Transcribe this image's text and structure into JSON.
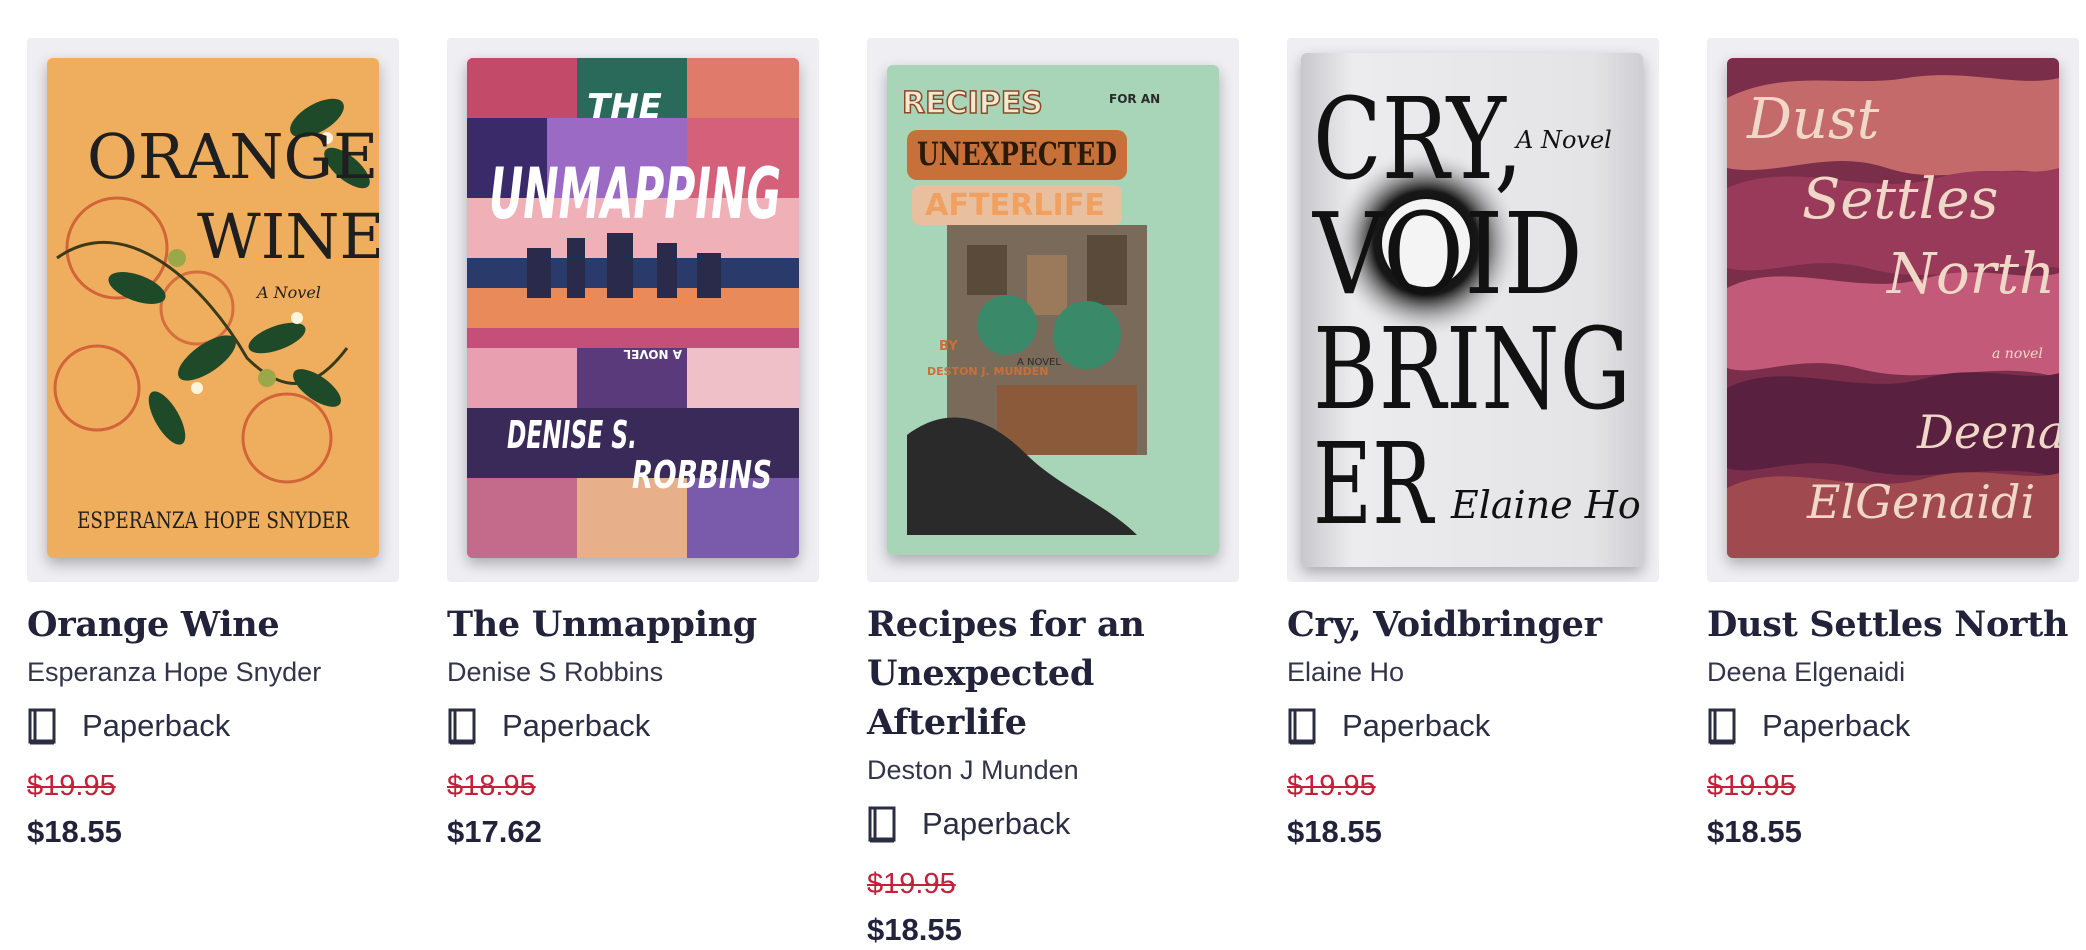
{
  "books": [
    {
      "title": "Orange Wine",
      "author": "Esperanza Hope Snyder",
      "format": "Paperback",
      "original_price": "$19.95",
      "sale_price": "$18.55",
      "cover": {
        "lines": [
          "ORANGE",
          "WINE"
        ],
        "tagline": "A Novel",
        "author_line": "ESPERANZA HOPE SNYDER",
        "bg": "#efae5e"
      }
    },
    {
      "title": "The Unmapping",
      "author": "Denise S Robbins",
      "format": "Paperback",
      "original_price": "$18.95",
      "sale_price": "$17.62",
      "cover": {
        "lines": [
          "THE",
          "UNMAPPING"
        ],
        "tagline": "A NOVEL",
        "author_line1": "DENISE S.",
        "author_line2": "ROBBINS",
        "bg": "#6b4a8c"
      }
    },
    {
      "title": "Recipes for an Unexpected Afterlife",
      "author": "Deston J Munden",
      "format": "Paperback",
      "original_price": "$19.95",
      "sale_price": "$18.55",
      "cover": {
        "line1": "RECIPES",
        "for_an": "FOR AN",
        "line2": "UNEXPECTED",
        "line3": "AFTERLIFE",
        "tagline": "A NOVEL",
        "by": "BY",
        "author_line": "DESTON J. MUNDEN",
        "bg": "#a8d4b8"
      }
    },
    {
      "title": "Cry, Voidbringer",
      "author": "Elaine Ho",
      "format": "Paperback",
      "original_price": "$19.95",
      "sale_price": "$18.55",
      "cover": {
        "lines": [
          "CRY,",
          "VOID",
          "BRING",
          "ER"
        ],
        "tagline": "A Novel",
        "author_line": "Elaine Ho",
        "bg": "#e4e4e6"
      }
    },
    {
      "title": "Dust Settles North",
      "author": "Deena Elgenaidi",
      "format": "Paperback",
      "original_price": "$19.95",
      "sale_price": "$18.55",
      "cover": {
        "lines": [
          "Dust",
          "Settles",
          "North"
        ],
        "tagline": "a novel",
        "author_line1": "Deena",
        "author_line2": "ElGenaidi",
        "bg": "#7a2e4a"
      }
    }
  ],
  "icons": {
    "format": "book-icon"
  },
  "colors": {
    "strike_price": "#c4203a",
    "text": "#22233a",
    "frame": "#eeeef3"
  }
}
